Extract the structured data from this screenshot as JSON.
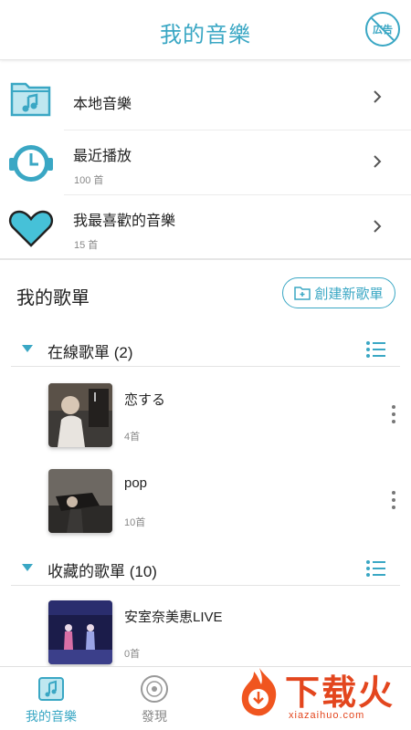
{
  "header": {
    "title": "我的音樂",
    "ad_label": "広告"
  },
  "quick_items": [
    {
      "title": "本地音樂",
      "sub": ""
    },
    {
      "title": "最近播放",
      "sub": "100 首"
    },
    {
      "title": "我最喜歡的音樂",
      "sub": "15 首"
    }
  ],
  "my_playlists": {
    "title": "我的歌單",
    "create_label": "創建新歌單"
  },
  "groups": [
    {
      "title": "在線歌單 (2)",
      "items": [
        {
          "title": "恋する",
          "count": "4首"
        },
        {
          "title": "pop",
          "count": "10首"
        }
      ]
    },
    {
      "title": "收藏的歌單 (10)",
      "items": [
        {
          "title": "安室奈美恵LIVE",
          "count": "0首"
        }
      ]
    }
  ],
  "tabs": [
    {
      "label": "我的音樂",
      "icon": "music-folder-icon",
      "active": true
    },
    {
      "label": "發現",
      "icon": "disc-icon",
      "active": false
    }
  ],
  "watermark": {
    "text": "下载火",
    "url": "xiazaihuo.com"
  },
  "colors": {
    "accent": "#3aa7c4",
    "text": "#222222",
    "muted": "#888888",
    "watermark": "#e3461e"
  }
}
